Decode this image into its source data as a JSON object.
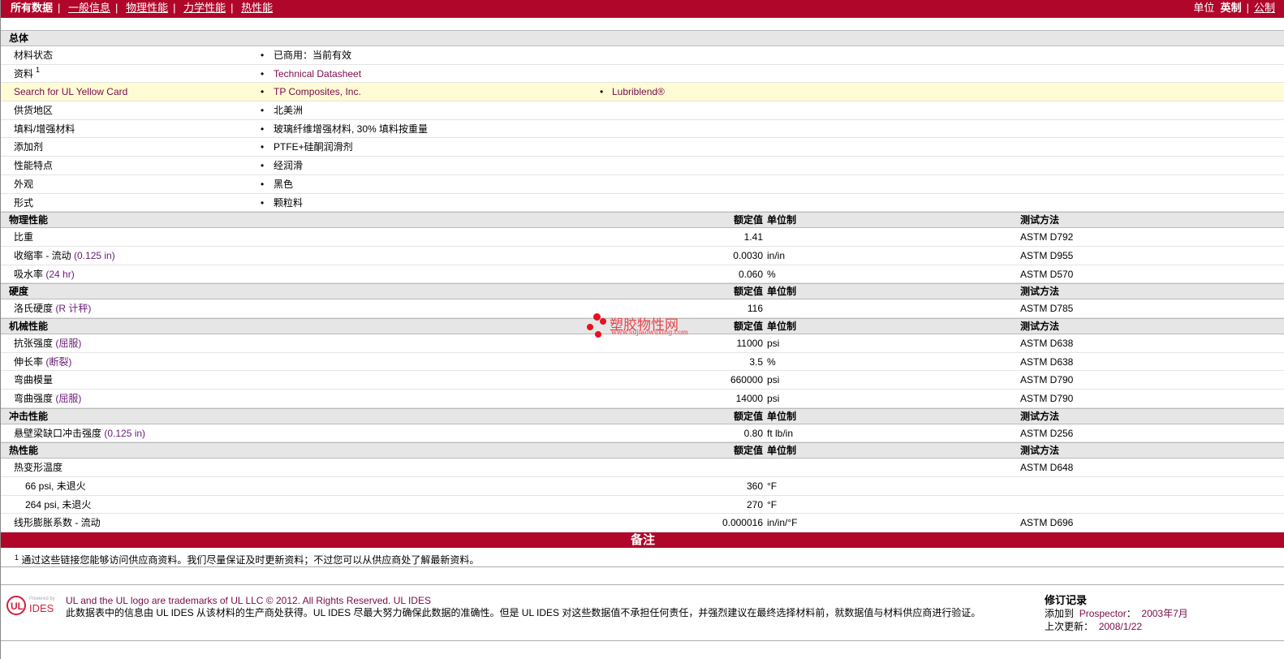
{
  "nav": {
    "items": [
      "所有数据",
      "一般信息",
      "物理性能",
      "力学性能",
      "热性能"
    ],
    "units_label": "单位",
    "unit_english": "英制",
    "unit_metric": "公制"
  },
  "general": {
    "title": "总体",
    "rows": [
      {
        "label": "材料状态",
        "values": [
          "已商用：当前有效"
        ]
      },
      {
        "label": "资料",
        "sup": "1",
        "values": [
          "Technical Datasheet"
        ],
        "link": true
      },
      {
        "label": "Search for UL Yellow Card",
        "values": [
          "TP Composites, Inc.",
          "Lubriblend®"
        ],
        "link": true,
        "highlight": true
      },
      {
        "label": "供货地区",
        "values": [
          "北美洲"
        ]
      },
      {
        "label": "填料/增强材料",
        "values": [
          "玻璃纤维增强材料, 30% 填料按重量"
        ]
      },
      {
        "label": "添加剂",
        "values": [
          "PTFE+硅酮润滑剂"
        ]
      },
      {
        "label": "性能特点",
        "values": [
          "经润滑"
        ]
      },
      {
        "label": "外观",
        "values": [
          "黑色"
        ]
      },
      {
        "label": "形式",
        "values": [
          "颗粒料"
        ]
      }
    ]
  },
  "col_headers": {
    "value": "额定值",
    "unit": "单位制",
    "method": "测试方法"
  },
  "sections": [
    {
      "title": "物理性能",
      "rows": [
        {
          "label": "比重",
          "value": "1.41",
          "unit": "",
          "method": "ASTM D792"
        },
        {
          "label": "收缩率 - 流动",
          "note": "(0.125 in)",
          "value": "0.0030",
          "unit": "in/in",
          "method": "ASTM D955"
        },
        {
          "label": "吸水率",
          "note": "(24 hr)",
          "value": "0.060",
          "unit": "%",
          "method": "ASTM D570"
        }
      ]
    },
    {
      "title": "硬度",
      "rows": [
        {
          "label": "洛氏硬度",
          "note": "(R 计秤)",
          "value": "116",
          "unit": "",
          "method": "ASTM D785"
        }
      ]
    },
    {
      "title": "机械性能",
      "rows": [
        {
          "label": "抗张强度",
          "note": "(屈服)",
          "value": "11000",
          "unit": "psi",
          "method": "ASTM D638"
        },
        {
          "label": "伸长率",
          "note": "(断裂)",
          "value": "3.5",
          "unit": "%",
          "method": "ASTM D638"
        },
        {
          "label": "弯曲模量",
          "value": "660000",
          "unit": "psi",
          "method": "ASTM D790"
        },
        {
          "label": "弯曲强度",
          "note": "(屈服)",
          "value": "14000",
          "unit": "psi",
          "method": "ASTM D790"
        }
      ]
    },
    {
      "title": "冲击性能",
      "rows": [
        {
          "label": "悬壁梁缺口冲击强度",
          "note": "(0.125 in)",
          "value": "0.80",
          "unit": "ft lb/in",
          "method": "ASTM D256"
        }
      ]
    },
    {
      "title": "热性能",
      "rows": [
        {
          "label": "热变形温度",
          "value": "",
          "unit": "",
          "method": "ASTM D648"
        },
        {
          "label": "66 psi, 未退火",
          "sub": true,
          "value": "360",
          "unit": "°F",
          "method": ""
        },
        {
          "label": "264 psi, 未退火",
          "sub": true,
          "value": "270",
          "unit": "°F",
          "method": ""
        },
        {
          "label": "线形膨胀系数 - 流动",
          "value": "0.000016",
          "unit": "in/in/°F",
          "method": "ASTM D696"
        }
      ]
    }
  ],
  "remarks": {
    "title": "备注",
    "footnote_num": "1",
    "footnote": "通过这些链接您能够访问供应商资料。我们尽量保证及时更新资料；不过您可以从供应商处了解最新资料。"
  },
  "footer": {
    "logo_powered": "Powered by",
    "logo_ul": "UL",
    "logo_ides": "IDES",
    "trademark": "UL and the UL logo are trademarks of UL LLC © 2012. All Rights Reserved.",
    "ul_ides_link": "UL IDES",
    "disclaimer": "此数据表中的信息由 UL IDES 从该材料的生产商处获得。UL IDES 尽最大努力确保此数据的准确性。但是 UL IDES 对这些数据值不承担任何责任，并强烈建议在最终选择材料前，就数据值与材料供应商进行验证。",
    "revision_title": "修订记录",
    "added_label": "添加到",
    "prospector": "Prospector",
    "added_date": "2003年7月",
    "updated_label": "上次更新：",
    "updated_date": "2008/1/22"
  },
  "watermark": {
    "text": "塑胶物性网",
    "url": "www.sujiaowuxing.com"
  }
}
